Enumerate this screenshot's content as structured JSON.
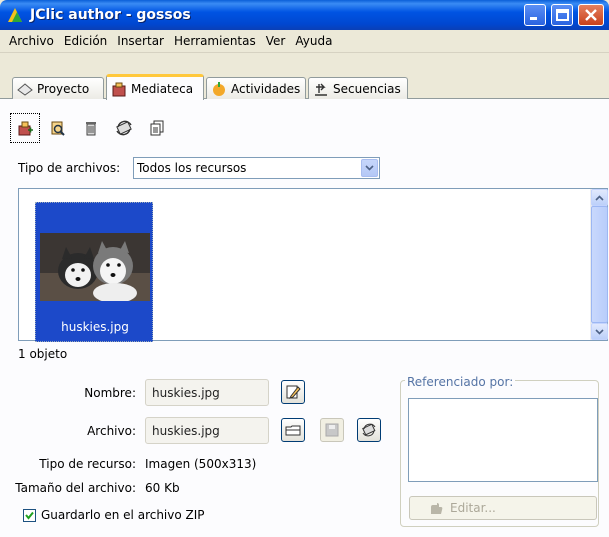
{
  "window": {
    "title": "JClic author - gossos"
  },
  "menu": [
    "Archivo",
    "Edición",
    "Insertar",
    "Herramientas",
    "Ver",
    "Ayuda"
  ],
  "tabs": [
    {
      "label": "Proyecto",
      "icon": "project-icon",
      "active": false
    },
    {
      "label": "Mediateca",
      "icon": "media-library-icon",
      "active": true
    },
    {
      "label": "Actividades",
      "icon": "activities-icon",
      "active": false
    },
    {
      "label": "Secuencias",
      "icon": "sequences-icon",
      "active": false
    }
  ],
  "toolbar": [
    "add-media-icon",
    "search-media-icon",
    "delete-icon",
    "update-icon",
    "copy-icon"
  ],
  "filter": {
    "label": "Tipo de archivos:",
    "value": "Todos los recursos"
  },
  "media": {
    "items": [
      {
        "name": "huskies.jpg",
        "selected": true
      }
    ],
    "count_text": "1 objeto"
  },
  "properties": {
    "name_label": "Nombre:",
    "name_value": "huskies.jpg",
    "file_label": "Archivo:",
    "file_value": "huskies.jpg",
    "type_label": "Tipo de recurso:",
    "type_value": "Imagen (500x313)",
    "size_label": "Tamaño del archivo:",
    "size_value": "60 Kb",
    "zip_label": "Guardarlo en el archivo ZIP",
    "zip_checked": true
  },
  "references": {
    "title": "Referenciado por:",
    "edit_label": "Editar..."
  },
  "colors": {
    "titlebar": "#0054e3",
    "selection": "#1c49c9",
    "tab_highlight": "#ffc83c"
  }
}
